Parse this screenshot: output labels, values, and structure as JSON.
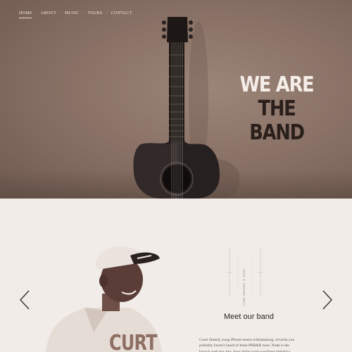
{
  "nav": {
    "items": [
      "HOME",
      "ABOUT",
      "MUSIC",
      "TOURS",
      "CONTACT"
    ]
  },
  "hero": {
    "headline_line1": "WE ARE",
    "headline_line2": "THE BAND"
  },
  "band": {
    "member_name": "CURT",
    "vertical_label": "CURT SHEARD ● BASS",
    "section_title": "Meet our band",
    "bio": "Court Sheard, swag iPhone neutra williamsburg, sriracha you probably haven't heard of them PBR&B twee. Nude is the brunch yeah but also. Four dollar toast wayfarers helvetica"
  },
  "icons": {
    "prev": "chevron-left-icon",
    "next": "chevron-right-icon"
  },
  "colors": {
    "hero_bg": "#8a7267",
    "headline_light": "#f4ede8",
    "headline_dark": "#2a1f1b",
    "section_bg": "#f2ece8",
    "name_accent": "#8e6f63"
  }
}
